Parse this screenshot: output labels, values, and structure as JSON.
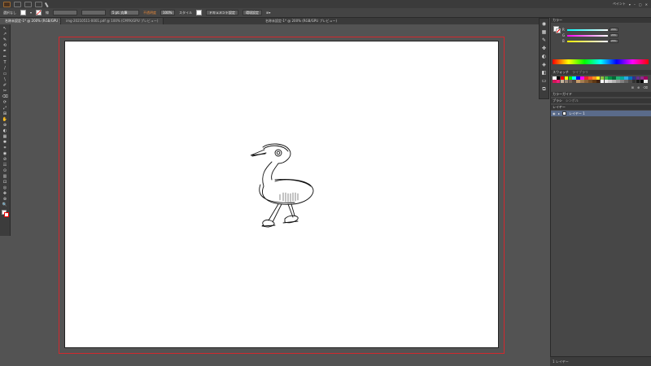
{
  "menubar": {
    "right_label": "ペイント"
  },
  "control_bar": {
    "selection_label": "選択なし",
    "stroke_weight": "5 pt. 丸筆",
    "opacity_label": "不透明度",
    "opacity_value": "100%",
    "style_label": "スタイル",
    "doc_setup_button": "ドキュメント設定",
    "preferences_button": "環境設定"
  },
  "document": {
    "window_title": "名称未設定-1* @ 200% (RGB/GPU プレビュー)",
    "tabs": [
      {
        "label": "名称未設定-1* @ 200% (RGB/GPU プレビュー)",
        "active": true
      },
      {
        "label": "img-20210511-0001.pdf @ 100% (CMYK/GPU プレビュー)",
        "active": false
      }
    ]
  },
  "tools": [
    "↖",
    "↗",
    "✎",
    "⟲",
    "✒",
    "✏",
    "T",
    "/",
    "▭",
    "\\",
    "✐",
    "✂",
    "⌫",
    "⟳",
    "⤢",
    "⊞",
    "✋",
    "⊕",
    "◐",
    "▦",
    "✱",
    "⌗",
    "◉",
    "⊘",
    "☷",
    "⊙",
    "▥",
    "⊡",
    "◎",
    "✥",
    "⊛",
    "🔍"
  ],
  "right_panel": {
    "color_tab": "カラー",
    "sliders": [
      {
        "label": "R",
        "value": "255",
        "gradient": "linear-gradient(90deg,#00ffff,#ffffff)"
      },
      {
        "label": "G",
        "value": "255",
        "gradient": "linear-gradient(90deg,#ff00ff,#ffffff)"
      },
      {
        "label": "B",
        "value": "255",
        "gradient": "linear-gradient(90deg,#ffff00,#ffffff)"
      }
    ],
    "swatches_tab": "スウォッチ",
    "libraries_tab": "ライブラリ",
    "color_guide_tab": "カラーガイド",
    "brush_tab": "ブラシ",
    "symbol_tab": "シンボル",
    "layers_tab": "レイヤー",
    "layer_name": "レイヤー 1",
    "layer_count": "1 レイヤー"
  },
  "swatch_colors": [
    "#ffffff",
    "#000000",
    "#ff0000",
    "#ffff00",
    "#00ff00",
    "#00ffff",
    "#0000ff",
    "#ff00ff",
    "#e8232a",
    "#f15a24",
    "#f7931e",
    "#fcee21",
    "#8cc63f",
    "#39b54a",
    "#009245",
    "#006837",
    "#22b573",
    "#00a99d",
    "#29abe2",
    "#0071bc",
    "#2e3192",
    "#662d91",
    "#93278f",
    "#9e005d",
    "#d4145a",
    "#ed1e79",
    "#c7b299",
    "#998675",
    "#736357",
    "#534741",
    "#c69c6d",
    "#a67c52",
    "#8c6239",
    "#754c24",
    "#603813",
    "#42210b",
    "#ffffff",
    "#e6e6e6",
    "#cccccc",
    "#b3b3b3",
    "#999999",
    "#808080",
    "#666666",
    "#4d4d4d",
    "#333333",
    "#1a1a1a",
    "#000000",
    "#f2f2f2"
  ]
}
